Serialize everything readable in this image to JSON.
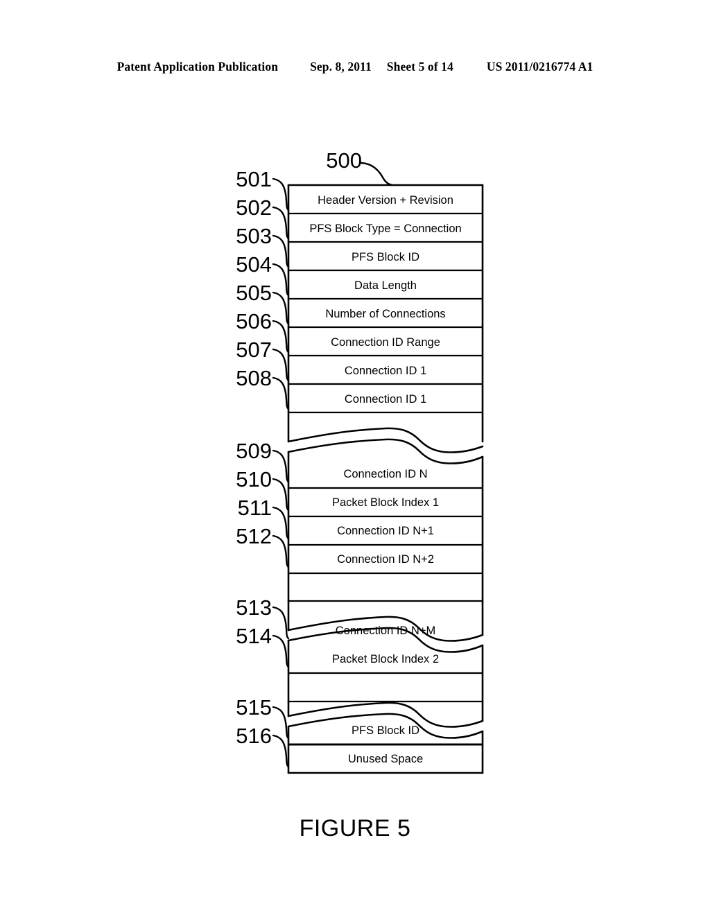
{
  "page_header": {
    "publication": "Patent Application Publication",
    "date": "Sep. 8, 2011",
    "sheet": "Sheet 5 of 14",
    "publication_number": "US 2011/0216774 A1"
  },
  "figure": {
    "caption": "FIGURE 5",
    "diagram_label": "500",
    "block_outline_color": "#000000",
    "text_color": "#000000",
    "background_color": "#ffffff",
    "rows": [
      {
        "ref": "501",
        "label": "Header Version + Revision"
      },
      {
        "ref": "502",
        "label": "PFS Block Type = Connection"
      },
      {
        "ref": "503",
        "label": "PFS Block ID"
      },
      {
        "ref": "504",
        "label": "Data Length"
      },
      {
        "ref": "505",
        "label": "Number of Connections"
      },
      {
        "ref": "506",
        "label": "Connection ID Range"
      },
      {
        "ref": "507",
        "label": "Connection ID 1"
      },
      {
        "ref": "508",
        "label": "Connection ID 1"
      },
      {
        "ref": "509",
        "label": "Connection ID N"
      },
      {
        "ref": "510",
        "label": "Packet Block Index 1"
      },
      {
        "ref": "511",
        "label": "Connection ID N+1"
      },
      {
        "ref": "512",
        "label": "Connection ID N+2"
      },
      {
        "ref": "513",
        "label": "Connection ID N+M"
      },
      {
        "ref": "514",
        "label": "Packet Block Index 2"
      },
      {
        "ref": "515",
        "label": "PFS Block ID"
      },
      {
        "ref": "516",
        "label": "Unused Space"
      }
    ],
    "break_count": 3,
    "break_note": "wavy torn-edge break separating block groups"
  }
}
